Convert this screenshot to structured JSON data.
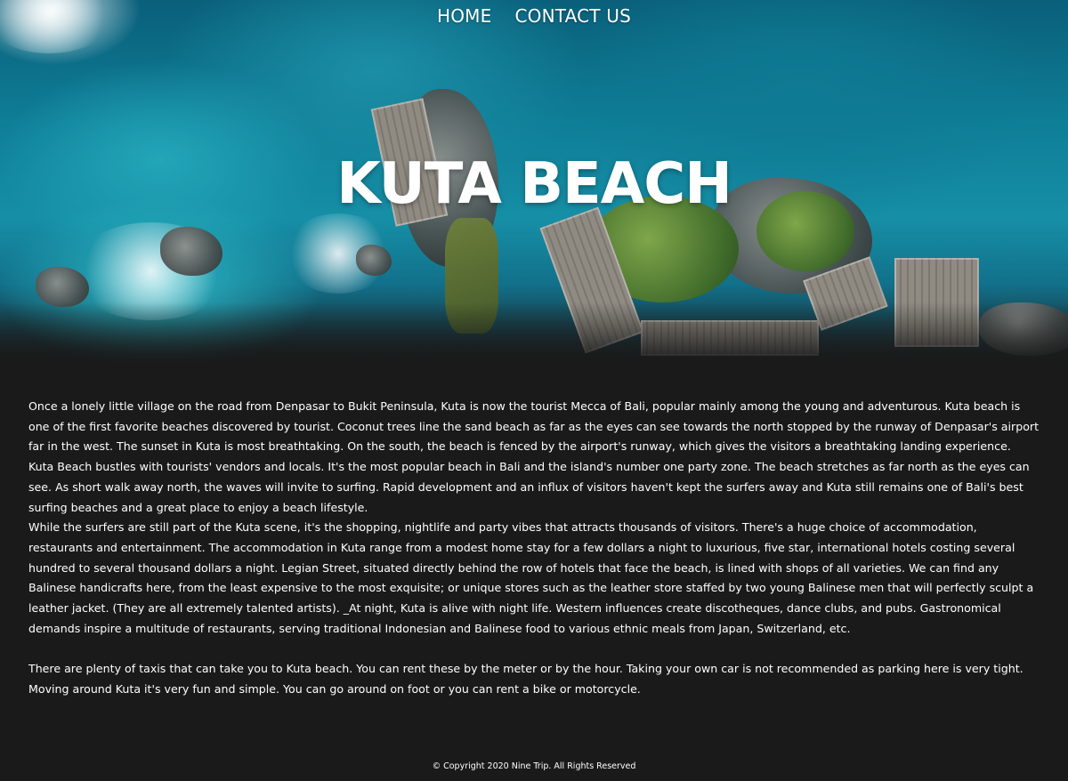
{
  "nav": {
    "home_label": "HOME",
    "contact_label": "CONTACT US"
  },
  "hero": {
    "title": "KUTA BEACH"
  },
  "content": {
    "paragraph_1": "Once a lonely little village on the road from Denpasar to Bukit Peninsula, Kuta is now the tourist Mecca of Bali, popular mainly among the young and adventurous. Kuta beach is one of the first favorite beaches discovered by tourist. Coconut trees line the sand beach as far as the eyes can see towards the north stopped by the runway of Denpasar's airport far in the west. The sunset in Kuta is most breathtaking. On the south, the beach is fenced by the airport's runway, which gives the visitors a breathtaking landing experience. Kuta Beach bustles with tourists' vendors and locals. It's the most popular beach in Bali and the island's number one party zone. The beach stretches as far north as the eyes can see. As short walk away north, the waves will invite to surfing. Rapid development and an influx of visitors haven't kept the surfers away and Kuta still remains one of Bali's best surfing beaches and a great place to enjoy a beach lifestyle.",
    "paragraph_2": "While the surfers are still part of the Kuta scene, it's the shopping, nightlife and party vibes that attracts thousands of visitors. There's a huge choice of accommodation, restaurants and entertainment. The accommodation in Kuta range from a modest home stay for a few dollars a night to luxurious, five star, international hotels costing several hundred to several thousand dollars a night. Legian Street, situated directly behind the row of hotels that face the beach, is lined with shops of all varieties. We can find any Balinese handicrafts here, from the least expensive to the most exquisite; or unique stores such as the leather store staffed by two young Balinese men that will perfectly sculpt a leather jacket. (They are all extremely talented artists). _At night, Kuta is alive with night life. Western influences create discotheques, dance clubs, and pubs. Gastronomical demands inspire a multitude of restaurants, serving traditional Indonesian and Balinese food to various ethnic meals from Japan, Switzerland, etc.",
    "paragraph_3": "There are plenty of taxis that can take you to Kuta beach. You can rent these by the meter or by the hour. Taking your own car is not recommended as parking here is very tight. Moving around Kuta it's very fun and simple. You can go around on foot or you can rent a bike or motorcycle."
  },
  "footer": {
    "copyright": "© Copyright 2020 Nine Trip. All Rights Reserved"
  },
  "colors": {
    "background": "#1a1a1a",
    "text": "#ffffff",
    "sea": "#168fa6"
  }
}
